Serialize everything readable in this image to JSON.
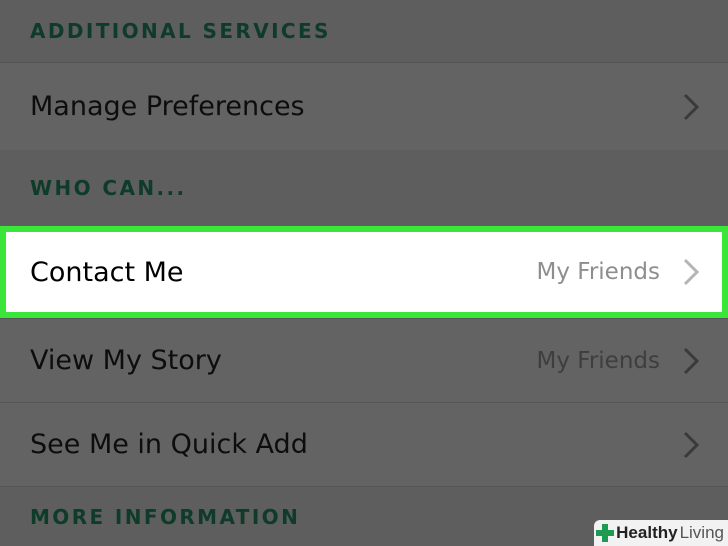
{
  "sections": {
    "additional_services": "ADDITIONAL SERVICES",
    "who_can": "WHO CAN...",
    "more_information": "MORE INFORMATION"
  },
  "rows": {
    "manage_preferences": {
      "label": "Manage Preferences"
    },
    "contact_me": {
      "label": "Contact Me",
      "value": "My Friends"
    },
    "view_my_story": {
      "label": "View My Story",
      "value": "My Friends"
    },
    "see_me_quick_add": {
      "label": "See Me in Quick Add"
    }
  },
  "watermark": {
    "part1": "Healthy",
    "part2": "Living"
  },
  "colors": {
    "highlight_border": "#39e639",
    "section_text": "#0e3b2a",
    "overlay": "#5e5e5e"
  }
}
